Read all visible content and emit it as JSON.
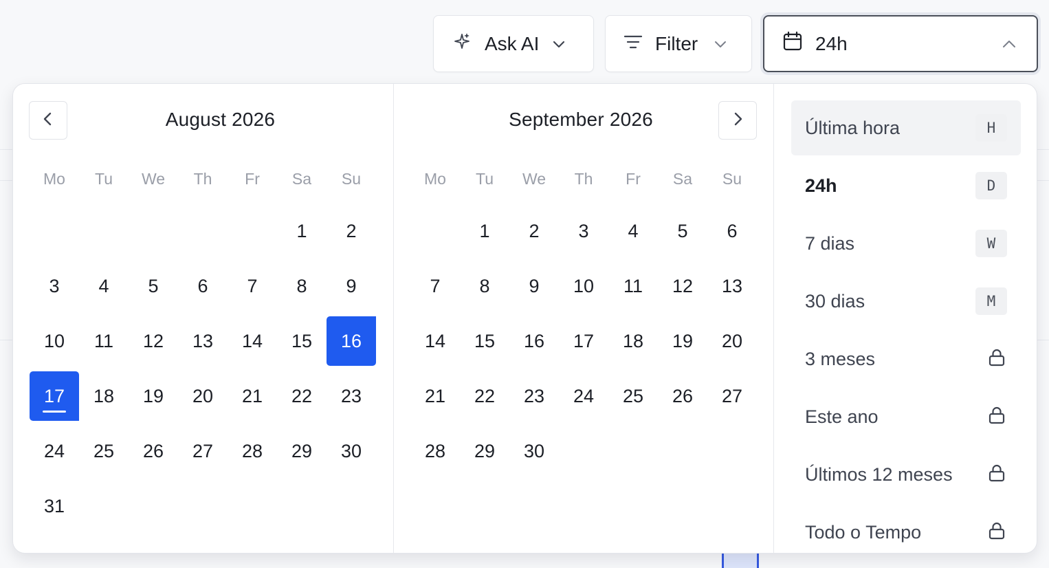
{
  "toolbar": {
    "ask_ai_label": "Ask AI",
    "filter_label": "Filter",
    "date_range_label": "24h"
  },
  "calendar": {
    "weekdays": [
      "Mo",
      "Tu",
      "We",
      "Th",
      "Fr",
      "Sa",
      "Su"
    ],
    "months": [
      {
        "title": "August 2026",
        "days": [
          null,
          null,
          null,
          null,
          null,
          "1",
          "2",
          "3",
          "4",
          "5",
          "6",
          "7",
          "8",
          "9",
          "10",
          "11",
          "12",
          "13",
          "14",
          "15",
          "16",
          "17",
          "18",
          "19",
          "20",
          "21",
          "22",
          "23",
          "24",
          "25",
          "26",
          "27",
          "28",
          "29",
          "30",
          "31"
        ]
      },
      {
        "title": "September 2026",
        "days": [
          null,
          "1",
          "2",
          "3",
          "4",
          "5",
          "6",
          "7",
          "8",
          "9",
          "10",
          "11",
          "12",
          "13",
          "14",
          "15",
          "16",
          "17",
          "18",
          "19",
          "20",
          "21",
          "22",
          "23",
          "24",
          "25",
          "26",
          "27",
          "28",
          "29",
          "30"
        ]
      }
    ],
    "selected_range": {
      "start": "16",
      "end": "17",
      "month": "August 2026"
    },
    "today": "17",
    "accent_color": "#1f5bef"
  },
  "presets": [
    {
      "label": "Última hora",
      "shortcut": "H",
      "state": "hover"
    },
    {
      "label": "24h",
      "shortcut": "D",
      "state": "active"
    },
    {
      "label": "7 dias",
      "shortcut": "W",
      "state": "normal"
    },
    {
      "label": "30 dias",
      "shortcut": "M",
      "state": "normal"
    },
    {
      "label": "3 meses",
      "icon": "lock-icon",
      "state": "locked"
    },
    {
      "label": "Este ano",
      "icon": "lock-icon",
      "state": "locked"
    },
    {
      "label": "Últimos 12 meses",
      "icon": "lock-icon",
      "state": "locked"
    },
    {
      "label": "Todo o Tempo",
      "icon": "lock-icon",
      "state": "locked"
    }
  ]
}
